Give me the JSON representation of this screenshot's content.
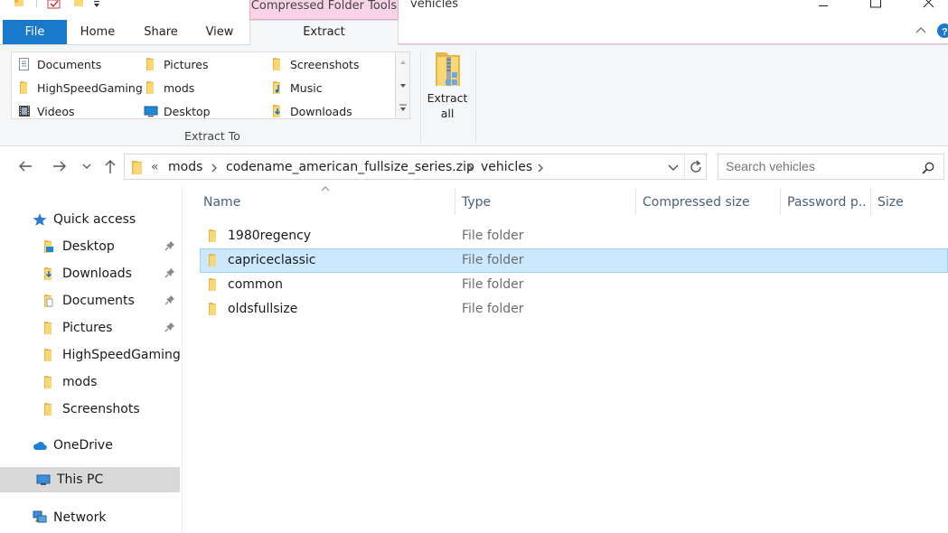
{
  "window": {
    "title": "vehicles",
    "contextual_tab_group": "Compressed Folder Tools"
  },
  "ribbon": {
    "tabs": [
      "File",
      "Home",
      "Share",
      "View",
      "Extract"
    ],
    "active_tab": "Extract",
    "extract_to": {
      "items": [
        "Documents",
        "Pictures",
        "Screenshots",
        "HighSpeedGaming",
        "mods",
        "Music",
        "Videos",
        "Desktop",
        "Downloads"
      ],
      "group_label": "Extract To"
    },
    "extract_all": {
      "line1": "Extract",
      "line2": "all"
    }
  },
  "address": {
    "overflow": "«",
    "crumbs": [
      "mods",
      "codename_american_fullsize_series.zip",
      "vehicles"
    ]
  },
  "search": {
    "placeholder": "Search vehicles"
  },
  "nav": {
    "quick_access": "Quick access",
    "quick_items": [
      "Desktop",
      "Downloads",
      "Documents",
      "Pictures",
      "HighSpeedGaming",
      "mods",
      "Screenshots"
    ],
    "onedrive": "OneDrive",
    "thispc": "This PC",
    "network": "Network"
  },
  "columns": [
    "Name",
    "Type",
    "Compressed size",
    "Password p...",
    "Size"
  ],
  "files": [
    {
      "name": "1980regency",
      "type": "File folder"
    },
    {
      "name": "capriceclassic",
      "type": "File folder",
      "selected": true
    },
    {
      "name": "common",
      "type": "File folder"
    },
    {
      "name": "oldsfullsize",
      "type": "File folder"
    }
  ],
  "colors": {
    "file_tab": "#1979ca",
    "context_tab": "#f9d3e6",
    "selection": "#cce8ff",
    "folder": "#f8d775"
  }
}
